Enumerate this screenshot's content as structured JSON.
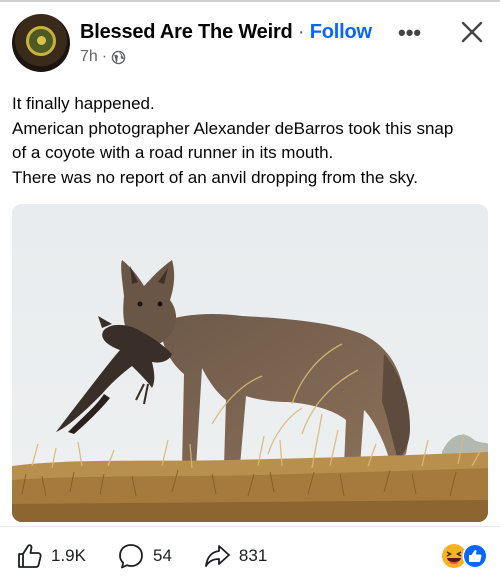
{
  "post": {
    "page_name": "Blessed Are The Weird",
    "separator": "·",
    "follow_label": "Follow",
    "time": "7h",
    "time_separator": "·",
    "lines": [
      "It finally happened.",
      "American photographer Alexander deBarros took this snap",
      "of a coyote with a road runner in its mouth.",
      "There was no report of an anvil dropping from the sky."
    ]
  },
  "footer": {
    "likes": "1.9K",
    "comments": "54",
    "shares": "831"
  },
  "icons": {
    "avatar": "page-avatar",
    "privacy": "globe-icon",
    "more": "more-options-icon",
    "close": "close-icon",
    "like": "thumbs-up-icon",
    "comment": "comment-icon",
    "share": "share-icon",
    "reactions": [
      "haha-reaction-icon",
      "like-reaction-icon"
    ]
  },
  "colors": {
    "follow": "#0866ff",
    "secondary_text": "#65676b",
    "like_reaction": "#0866ff",
    "haha_reaction": "#f7b125"
  }
}
